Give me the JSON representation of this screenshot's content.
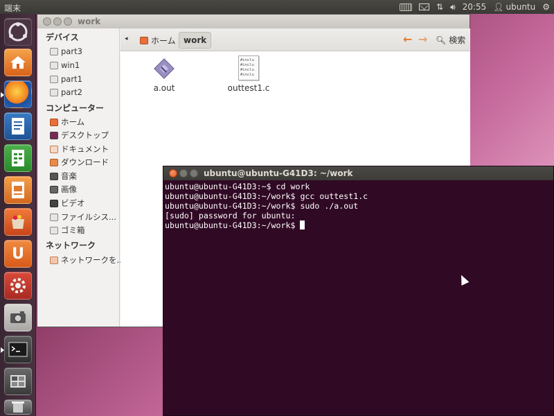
{
  "top_panel": {
    "app_title": "端末",
    "clock": "20:55",
    "user": "ubuntu",
    "icons": [
      "keyboard-icon",
      "mail-icon",
      "network-icon",
      "volume-icon",
      "user-icon",
      "gear-icon"
    ]
  },
  "launcher": {
    "items": [
      "dash",
      "home-folder",
      "firefox",
      "writer",
      "calc",
      "impress",
      "software-center",
      "ubuntu-one",
      "settings",
      "camera",
      "terminal",
      "workspace-switcher",
      "trash"
    ]
  },
  "file_manager": {
    "title": "work",
    "sidebar": {
      "devices_header": "デバイス",
      "devices": [
        "part3",
        "win1",
        "part1",
        "part2"
      ],
      "computer_header": "コンピューター",
      "computer": [
        "ホーム",
        "デスクトップ",
        "ドキュメント",
        "ダウンロード",
        "音楽",
        "画像",
        "ビデオ",
        "ファイルシス...",
        "ゴミ箱"
      ],
      "network_header": "ネットワーク",
      "network": [
        "ネットワークを..."
      ]
    },
    "breadcrumb": {
      "home": "ホーム",
      "current": "work"
    },
    "search_label": "検索",
    "files": [
      {
        "name": "a.out",
        "icon": "executable-icon"
      },
      {
        "name": "outtest1.c",
        "icon": "c-source-icon"
      }
    ],
    "c_preview_lines": [
      "#inclu",
      "#inclu",
      "#inclu",
      "#inclu"
    ]
  },
  "terminal": {
    "title": "ubuntu@ubuntu-G41D3: ~/work",
    "lines": [
      "ubuntu@ubuntu-G41D3:~$ cd work",
      "ubuntu@ubuntu-G41D3:~/work$ gcc outtest1.c",
      "ubuntu@ubuntu-G41D3:~/work$ sudo ./a.out",
      "[sudo] password for ubuntu:",
      "ubuntu@ubuntu-G41D3:~/work$ "
    ]
  },
  "colors": {
    "terminal_bg": "#300a24",
    "panel_bg": "#3c3b37",
    "close_orange": "#e25a21"
  }
}
